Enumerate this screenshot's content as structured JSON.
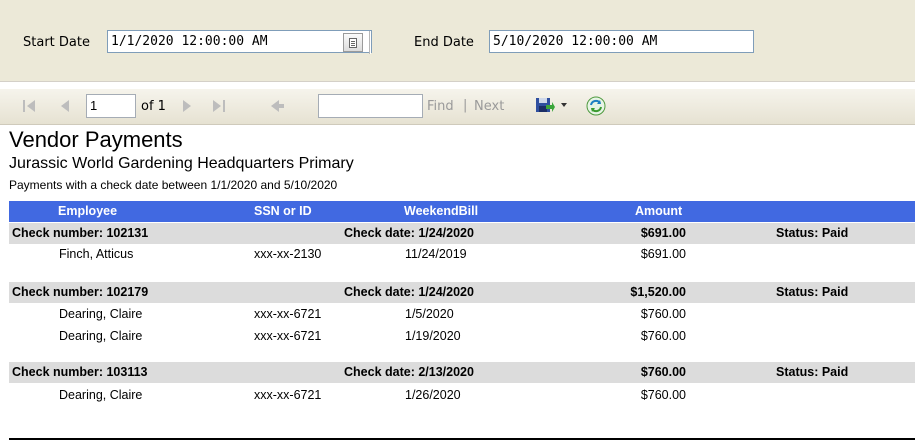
{
  "parameters": {
    "start_label": "Start Date",
    "start_value": "1/1/2020 12:00:00 AM",
    "end_label": "End Date",
    "end_value": "5/10/2020 12:00:00 AM"
  },
  "toolbar": {
    "page_current": "1",
    "page_of": "of 1",
    "find_placeholder": "",
    "find_label": "Find",
    "separator": "|",
    "next_label": "Next"
  },
  "report": {
    "title": "Vendor Payments",
    "subtitle": "Jurassic World Gardening Headquarters Primary",
    "description": "Payments with a check date between 1/1/2020 and 5/10/2020",
    "columns": [
      "Employee",
      "SSN or ID",
      "WeekendBill",
      "Amount"
    ],
    "checks": [
      {
        "check_number": "Check number: 102131",
        "check_date": "Check date: 1/24/2020",
        "total": "$691.00",
        "status": "Status: Paid",
        "payments": [
          {
            "employee": "Finch, Atticus",
            "ssn": "xxx-xx-2130",
            "weekend_bill": "11/24/2019",
            "amount": "$691.00"
          }
        ]
      },
      {
        "check_number": "Check number: 102179",
        "check_date": "Check date: 1/24/2020",
        "total": "$1,520.00",
        "status": "Status: Paid",
        "payments": [
          {
            "employee": "Dearing, Claire",
            "ssn": "xxx-xx-6721",
            "weekend_bill": "1/5/2020",
            "amount": "$760.00"
          },
          {
            "employee": "Dearing, Claire",
            "ssn": "xxx-xx-6721",
            "weekend_bill": "1/19/2020",
            "amount": "$760.00"
          }
        ]
      },
      {
        "check_number": "Check number: 103113",
        "check_date": "Check date: 2/13/2020",
        "total": "$760.00",
        "status": "Status: Paid",
        "payments": [
          {
            "employee": "Dearing, Claire",
            "ssn": "xxx-xx-6721",
            "weekend_bill": "1/26/2020",
            "amount": "$760.00"
          }
        ]
      }
    ]
  },
  "icons": {
    "first_page": "first-page-icon",
    "previous_page": "previous-page-icon",
    "next_page": "next-page-icon",
    "last_page": "last-page-icon",
    "back": "back-to-parent-icon",
    "export": "export-save-icon",
    "refresh": "refresh-icon",
    "date_picker": "calendar-icon"
  },
  "colors": {
    "header_blue": "#4169e1",
    "group_row_gray": "#dcdcdc",
    "parameter_bg": "#ece9d8"
  }
}
